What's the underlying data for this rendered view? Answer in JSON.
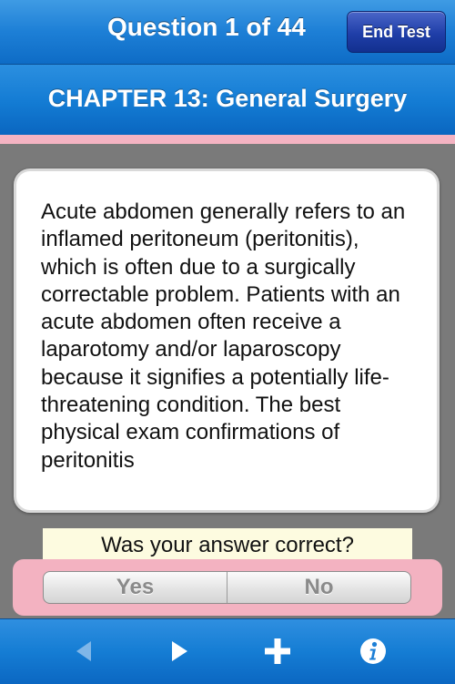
{
  "navbar": {
    "title": "Question 1 of 44",
    "end_test_label": "End Test"
  },
  "chapter": {
    "title": "CHAPTER 13: General Surgery"
  },
  "question": {
    "text": "Acute abdomen generally refers to an inflamed peritoneum (peritonitis), which is often due to a surgically correctable problem. Patients with an acute abdomen often receive a laparotomy and/or laparoscopy because it signifies a potentially life-threatening condition. The best physical exam confirmations of peritonitis"
  },
  "answer_prompt": {
    "text": "Was your answer correct?",
    "yes_label": "Yes",
    "no_label": "No"
  },
  "toolbar": {
    "items": [
      {
        "icon": "back-arrow-icon",
        "enabled": false
      },
      {
        "icon": "forward-arrow-icon",
        "enabled": true
      },
      {
        "icon": "plus-icon",
        "enabled": true
      },
      {
        "icon": "info-icon",
        "enabled": true
      }
    ]
  },
  "colors": {
    "nav_blue": "#1d7fd6",
    "end_button_blue": "#1f3ea8",
    "pink_accent": "#f3b2c1",
    "prompt_background": "#fdfbe0",
    "page_gray": "#7a7a7a"
  }
}
